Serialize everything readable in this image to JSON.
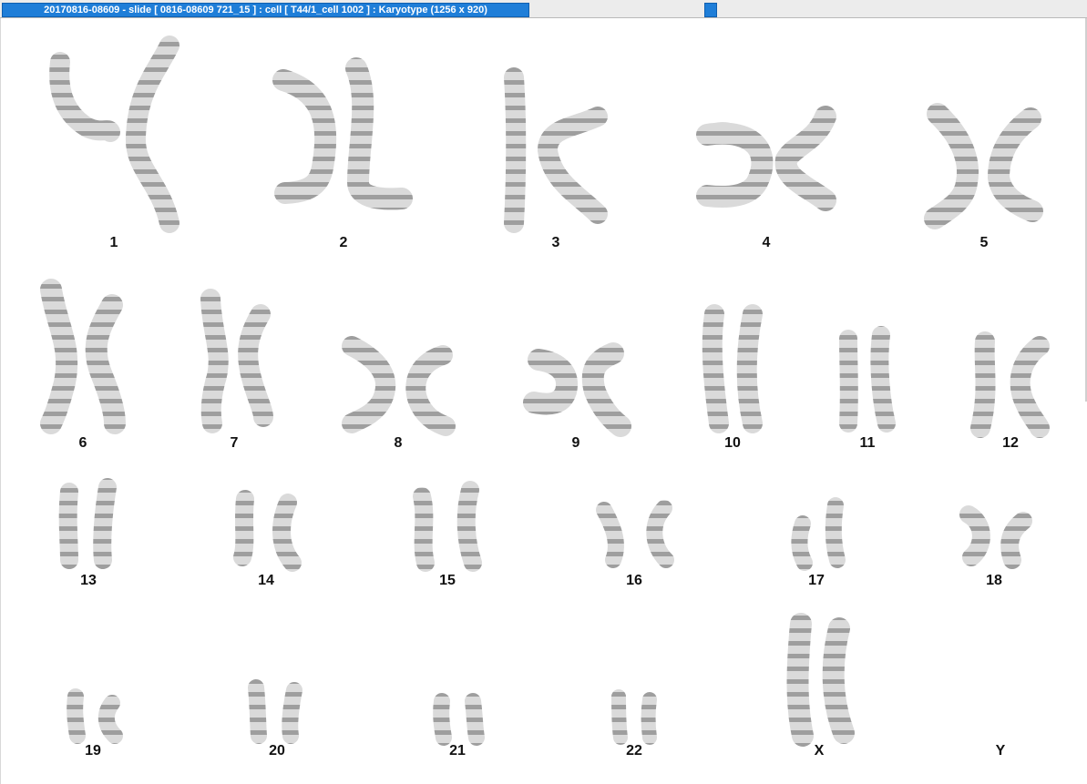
{
  "window": {
    "title": "20170816-08609 - slide [ 0816-08609 721_15 ] : cell [ T44/1_cell 1002 ] : Karyotype  (1256 x 920)"
  },
  "colors": {
    "title_bar": "#1f7ed8",
    "background": "#ffffff",
    "chromosome_light": "#d6d6d6",
    "chromosome_dark": "#5a5a5a"
  },
  "karyotype": {
    "labels": [
      "1",
      "2",
      "3",
      "4",
      "5",
      "6",
      "7",
      "8",
      "9",
      "10",
      "11",
      "12",
      "13",
      "14",
      "15",
      "16",
      "17",
      "18",
      "19",
      "20",
      "21",
      "22",
      "X",
      "Y"
    ]
  }
}
